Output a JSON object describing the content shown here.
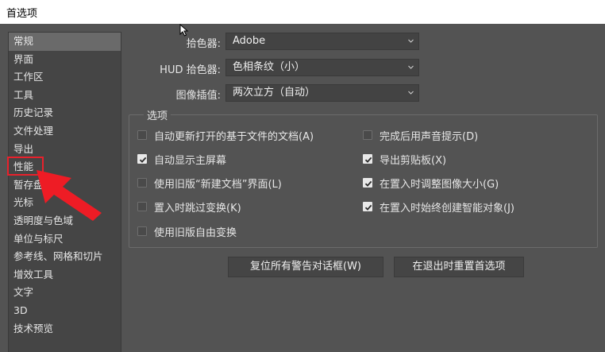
{
  "window": {
    "title": "首选项"
  },
  "sidebar": {
    "items": [
      {
        "label": "常规"
      },
      {
        "label": "界面"
      },
      {
        "label": "工作区"
      },
      {
        "label": "工具"
      },
      {
        "label": "历史记录"
      },
      {
        "label": "文件处理"
      },
      {
        "label": "导出"
      },
      {
        "label": "性能"
      },
      {
        "label": "暂存盘"
      },
      {
        "label": "光标"
      },
      {
        "label": "透明度与色域"
      },
      {
        "label": "单位与标尺"
      },
      {
        "label": "参考线、网格和切片"
      },
      {
        "label": "增效工具"
      },
      {
        "label": "文字"
      },
      {
        "label": "3D"
      },
      {
        "label": "技术预览"
      }
    ],
    "selected_index": 0,
    "annotated_item": "性能"
  },
  "fields": {
    "color_picker": {
      "label": "拾色器:",
      "value": "Adobe"
    },
    "hud_color_picker": {
      "label": "HUD 拾色器:",
      "value": "色相条纹（小）"
    },
    "image_interpolation": {
      "label": "图像插值:",
      "value": "两次立方（自动）"
    }
  },
  "options": {
    "legend": "选项",
    "left": [
      {
        "label": "自动更新打开的基于文件的文档(A)",
        "checked": false
      },
      {
        "label": "自动显示主屏幕",
        "checked": true
      },
      {
        "label": "使用旧版“新建文档”界面(L)",
        "checked": false
      },
      {
        "label": "置入时跳过变换(K)",
        "checked": false
      },
      {
        "label": "使用旧版自由变换",
        "checked": false
      }
    ],
    "right": [
      {
        "label": "完成后用声音提示(D)",
        "checked": false
      },
      {
        "label": "导出剪贴板(X)",
        "checked": true
      },
      {
        "label": "在置入时调整图像大小(G)",
        "checked": true
      },
      {
        "label": "在置入时始终创建智能对象(J)",
        "checked": true
      }
    ]
  },
  "buttons": {
    "reset_warnings": "复位所有警告对话框(W)",
    "reset_prefs_on_quit": "在退出时重置首选项"
  },
  "colors": {
    "background": "#535353",
    "sidebar": "#454545",
    "annotation": "#e8212c"
  }
}
